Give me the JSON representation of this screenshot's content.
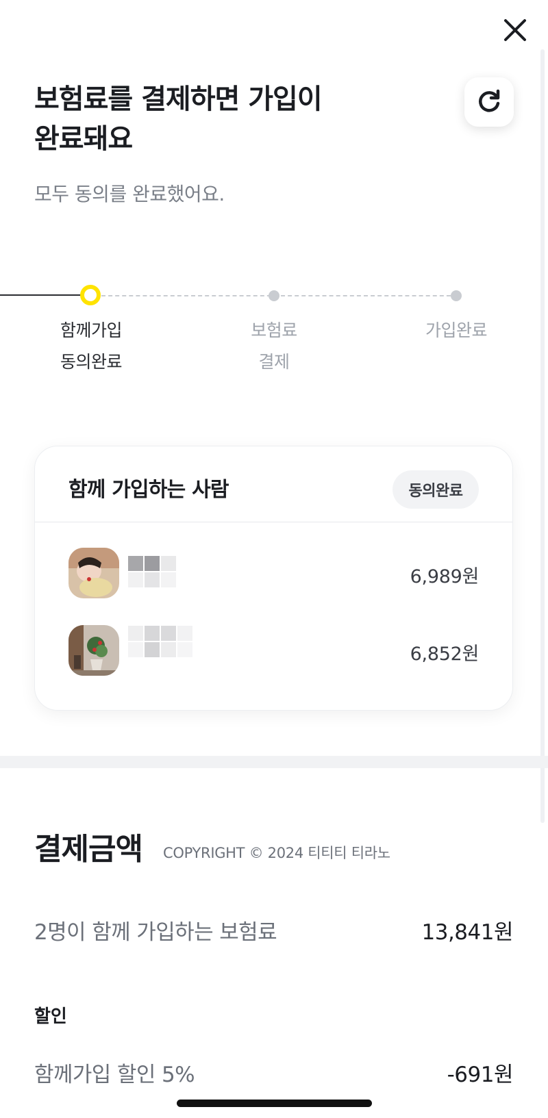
{
  "header": {
    "title_line1": "보험료를 결제하면 가입이",
    "title_line2": "완료돼요",
    "subtitle": "모두 동의를 완료했어요."
  },
  "steps": [
    {
      "line1": "함께가입",
      "line2": "동의완료",
      "state": "current"
    },
    {
      "line1": "보험료",
      "line2": "결제",
      "state": "pending"
    },
    {
      "line1": "가입완료",
      "line2": "",
      "state": "pending"
    }
  ],
  "members_card": {
    "title": "함께 가입하는 사람",
    "badge": "동의완료",
    "members": [
      {
        "avatar": "person-photo",
        "amount": "6,989원"
      },
      {
        "avatar": "plant-photo",
        "amount": "6,852원"
      }
    ]
  },
  "payment": {
    "title": "결제금액",
    "copyright": "COPYRIGHT © 2024 티티티 티라노",
    "total_label": "2명이 함께 가입하는 보험료",
    "total_value": "13,841원",
    "discount_heading": "할인",
    "discount_label": "함께가입 할인 5%",
    "discount_value": "-691원"
  },
  "colors": {
    "accent_yellow": "#ffe300",
    "text_primary": "#1b1d22",
    "text_secondary": "#7a7f88",
    "inactive": "#c9ccd1"
  },
  "icons": {
    "close": "close-icon",
    "refresh": "refresh-icon"
  }
}
